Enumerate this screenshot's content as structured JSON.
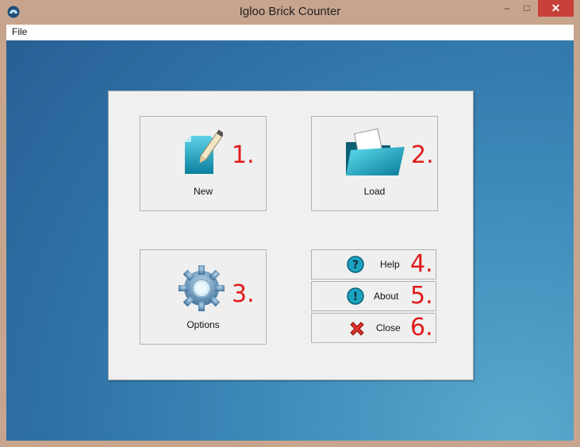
{
  "window": {
    "title": "Igloo Brick Counter",
    "controls": {
      "minimize": "–",
      "maximize": "□",
      "close": "✕"
    }
  },
  "menu": {
    "file_label": "File"
  },
  "buttons": {
    "new": {
      "label": "New",
      "number": "1."
    },
    "load": {
      "label": "Load",
      "number": "2."
    },
    "options": {
      "label": "Options",
      "number": "3."
    },
    "help": {
      "label": "Help",
      "number": "4."
    },
    "about": {
      "label": "About",
      "number": "5."
    },
    "close": {
      "label": "Close",
      "number": "6."
    }
  },
  "icons": {
    "app": "igloo-icon",
    "new": "document-pencil-icon",
    "load": "folder-icon",
    "options": "gear-icon",
    "help": "question-icon",
    "about": "info-icon",
    "close": "red-x-icon"
  },
  "colors": {
    "annotation_red": "#e11b1b",
    "close_button": "#c7403b",
    "icon_teal": "#1ba3c2"
  }
}
